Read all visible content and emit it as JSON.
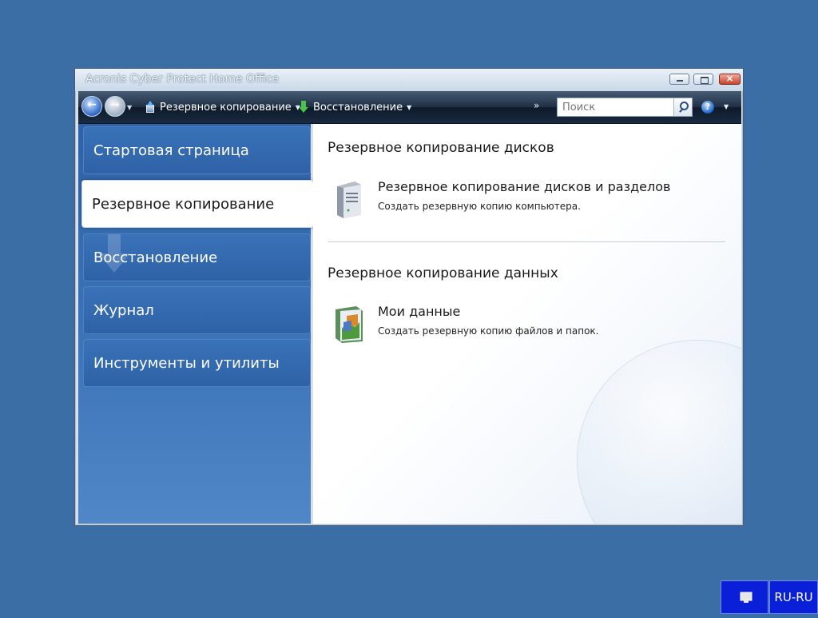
{
  "window": {
    "title": "Acronis Cyber Protect Home Office"
  },
  "toolbar": {
    "backup_label": "Резервное копирование",
    "restore_label": "Восстановление",
    "more": "»",
    "search_placeholder": "Поиск",
    "help": "?"
  },
  "sidebar": {
    "items": [
      {
        "label": "Стартовая страница",
        "active": false
      },
      {
        "label": "Резервное копирование",
        "active": true
      },
      {
        "label": "Восстановление",
        "active": false
      },
      {
        "label": "Журнал",
        "active": false
      },
      {
        "label": "Инструменты и утилиты",
        "active": false
      }
    ]
  },
  "content": {
    "sections": [
      {
        "title": "Резервное копирование дисков",
        "task": {
          "title": "Резервное копирование дисков и разделов",
          "description": "Создать резервную копию компьютера.",
          "icon": "server-icon"
        }
      },
      {
        "title": "Резервное копирование данных",
        "task": {
          "title": "Мои данные",
          "description": "Создать резервную копию файлов и папок.",
          "icon": "my-data-icon"
        }
      }
    ]
  },
  "taskbar": {
    "language": "RU-RU"
  },
  "colors": {
    "desktop": "#3a6ea5",
    "sidebar": "#3c74b8",
    "toolbar": "#1f2f44",
    "tray": "#0a1fd8"
  }
}
